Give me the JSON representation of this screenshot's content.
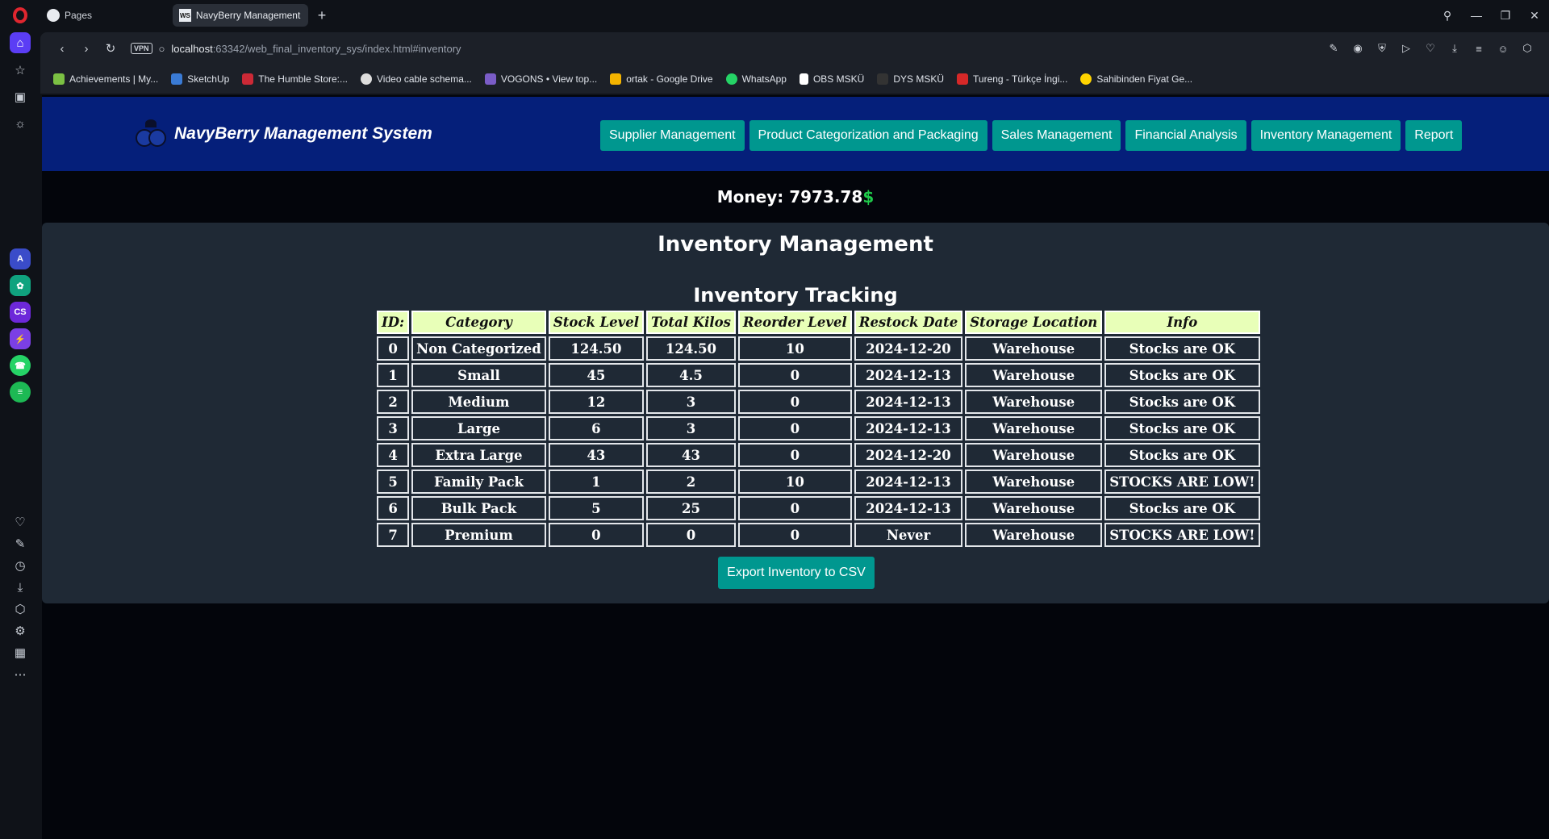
{
  "browser": {
    "tabs": [
      {
        "label": "Pages",
        "icon": "github-icon"
      },
      {
        "label": "NavyBerry Management S",
        "icon": "webstorm-icon"
      }
    ],
    "address": {
      "host": "localhost",
      "rest": ":63342/web_final_inventory_sys/index.html#inventory"
    },
    "vpn_label": "VPN",
    "bookmarks": [
      {
        "label": "Achievements | My...",
        "color": "#7bc043"
      },
      {
        "label": "SketchUp",
        "color": "#3a7bd5"
      },
      {
        "label": "The Humble Store:...",
        "color": "#cc2936"
      },
      {
        "label": "Video cable schema...",
        "color": "#dddddd"
      },
      {
        "label": "VOGONS • View top...",
        "color": "#7a5cc7"
      },
      {
        "label": "ortak - Google Drive",
        "color": "#f4b400"
      },
      {
        "label": "WhatsApp",
        "color": "#25d366"
      },
      {
        "label": "OBS MSKÜ",
        "color": "#ffffff"
      },
      {
        "label": "DYS MSKÜ",
        "color": "#333333"
      },
      {
        "label": "Tureng - Türkçe İngi...",
        "color": "#d62828"
      },
      {
        "label": "Sahibinden Fiyat Ge...",
        "color": "#ffd400"
      }
    ]
  },
  "site": {
    "title": "NavyBerry Management System",
    "nav": [
      "Supplier Management",
      "Product Categorization and Packaging",
      "Sales Management",
      "Financial Analysis",
      "Inventory Management",
      "Report"
    ],
    "money_label": "Money:",
    "money_value": "7973.78",
    "currency": "$"
  },
  "inventory": {
    "title": "Inventory Management",
    "subtitle": "Inventory Tracking",
    "columns": [
      "ID:",
      "Category",
      "Stock Level",
      "Total Kilos",
      "Reorder Level",
      "Restock Date",
      "Storage Location",
      "Info"
    ],
    "rows": [
      [
        "0",
        "Non Categorized",
        "124.50",
        "124.50",
        "10",
        "2024-12-20",
        "Warehouse",
        "Stocks are OK"
      ],
      [
        "1",
        "Small",
        "45",
        "4.5",
        "0",
        "2024-12-13",
        "Warehouse",
        "Stocks are OK"
      ],
      [
        "2",
        "Medium",
        "12",
        "3",
        "0",
        "2024-12-13",
        "Warehouse",
        "Stocks are OK"
      ],
      [
        "3",
        "Large",
        "6",
        "3",
        "0",
        "2024-12-13",
        "Warehouse",
        "Stocks are OK"
      ],
      [
        "4",
        "Extra Large",
        "43",
        "43",
        "0",
        "2024-12-20",
        "Warehouse",
        "Stocks are OK"
      ],
      [
        "5",
        "Family Pack",
        "1",
        "2",
        "10",
        "2024-12-13",
        "Warehouse",
        "STOCKS ARE LOW!"
      ],
      [
        "6",
        "Bulk Pack",
        "5",
        "25",
        "0",
        "2024-12-13",
        "Warehouse",
        "Stocks are OK"
      ],
      [
        "7",
        "Premium",
        "0",
        "0",
        "0",
        "Never",
        "Warehouse",
        "STOCKS ARE LOW!"
      ]
    ],
    "export_label": "Export Inventory to CSV"
  },
  "colors": {
    "header_bg": "#051f7a",
    "accent_button": "#00978f",
    "table_header_bg": "#e8ffb8",
    "panel_bg": "#1f2935",
    "dollar_green": "#1fc94a"
  }
}
